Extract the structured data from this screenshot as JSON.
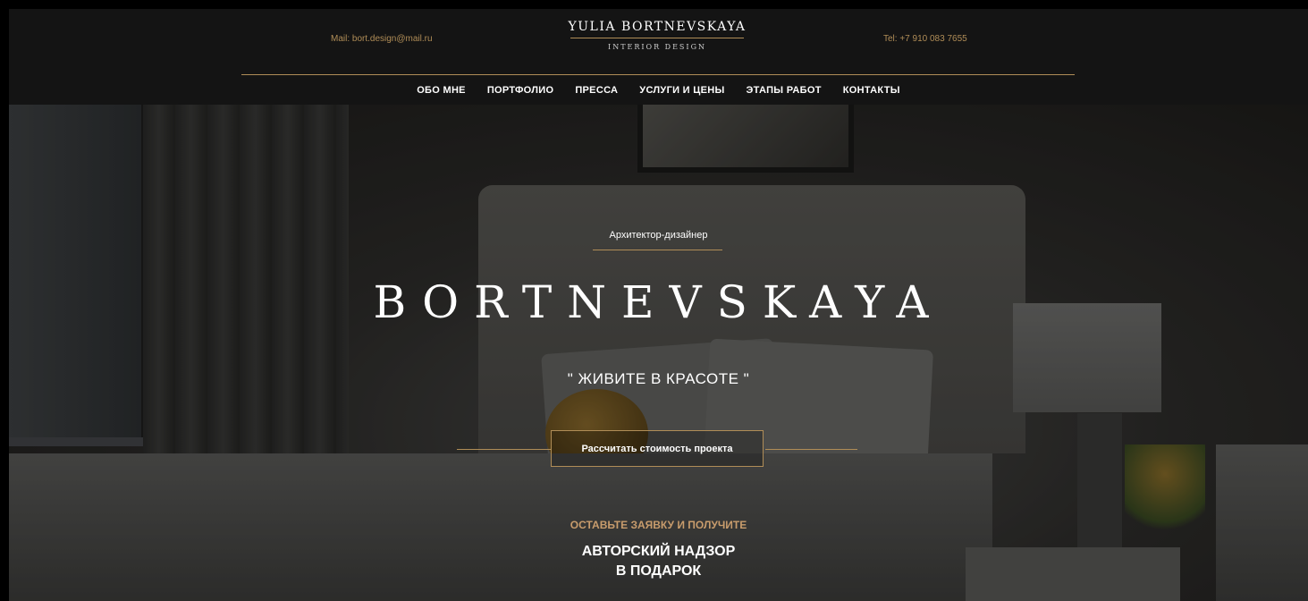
{
  "header": {
    "mail": "Mail: bort.design@mail.ru",
    "tel": "Tel: +7 910 083 7655",
    "brand_name": "YULIA BORTNEVSKAYA",
    "brand_sub": "INTERIOR DESIGN"
  },
  "nav": {
    "items": [
      {
        "label": "ОБО МНЕ"
      },
      {
        "label": "ПОРТФОЛИО"
      },
      {
        "label": "ПРЕССА"
      },
      {
        "label": "УСЛУГИ И ЦЕНЫ"
      },
      {
        "label": "ЭТАПЫ РАБОТ"
      },
      {
        "label": "КОНТАКТЫ"
      }
    ]
  },
  "hero": {
    "subtitle": "Архитектор-дизайнер",
    "title": "BORTNEVSKAYA",
    "slogan": "\" ЖИВИТЕ В КРАСОТЕ \"",
    "cta_label": "Рассчитать стоимость проекта",
    "offer_lead": "ОСТАВЬТЕ ЗАЯВКУ И ПОЛУЧИТЕ",
    "offer_line1": "АВТОРСКИЙ НАДЗОР",
    "offer_line2": "В ПОДАРОК"
  },
  "colors": {
    "accent": "#b08d57",
    "offer_accent": "#c89c6c",
    "header_bg": "#141414"
  }
}
